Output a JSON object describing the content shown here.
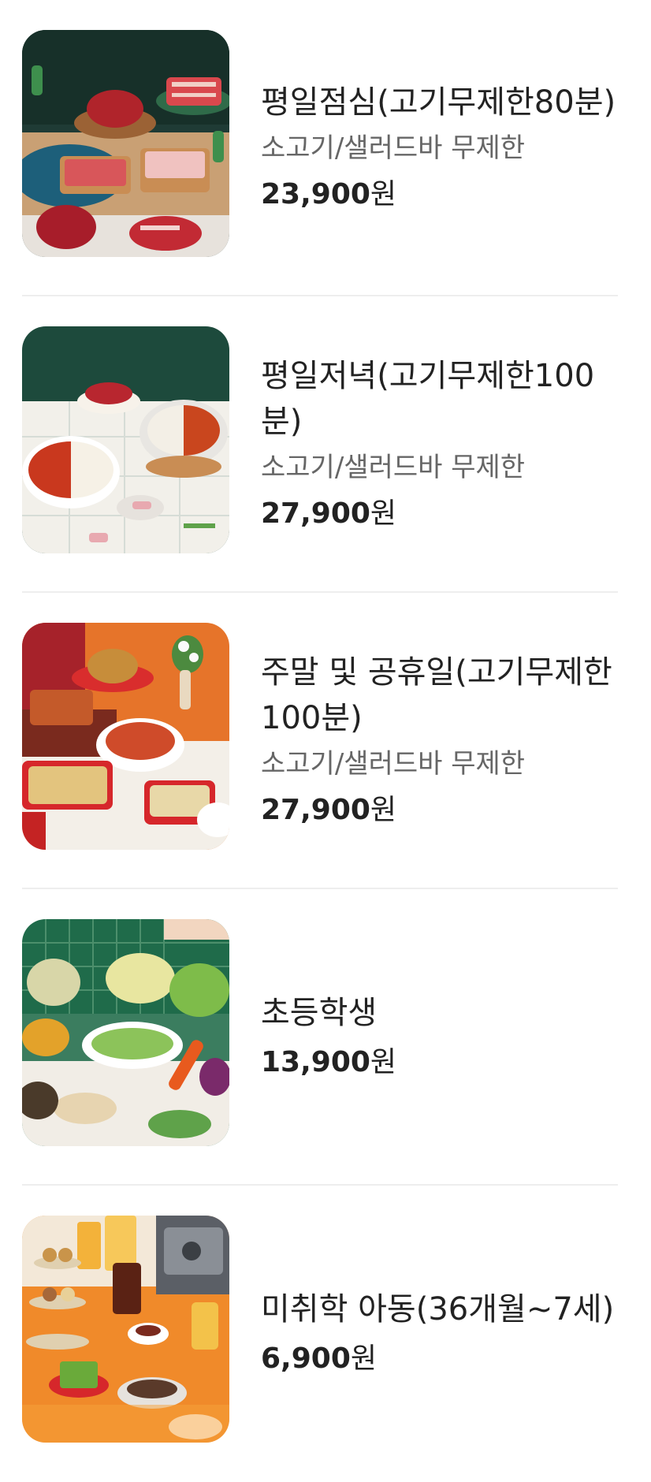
{
  "menu": {
    "items": [
      {
        "name": "평일점심(고기무제한80분)",
        "description": "소고기/샐러드바 무제한",
        "price": "23,900",
        "currency": "원",
        "image_icon": "beef-platter-image"
      },
      {
        "name": "평일저녁(고기무제한100분)",
        "description": "소고기/샐러드바 무제한",
        "price": "27,900",
        "currency": "원",
        "image_icon": "hotpot-image"
      },
      {
        "name": "주말 및 공휴일(고기무제한100분)",
        "description": "소고기/샐러드바 무제한",
        "price": "27,900",
        "currency": "원",
        "image_icon": "buffet-dishes-image"
      },
      {
        "name": "초등학생",
        "price": "13,900",
        "currency": "원",
        "image_icon": "vegetables-image"
      },
      {
        "name": "미취학 아동(36개월~7세)",
        "price": "6,900",
        "currency": "원",
        "image_icon": "dessert-table-image"
      }
    ]
  }
}
